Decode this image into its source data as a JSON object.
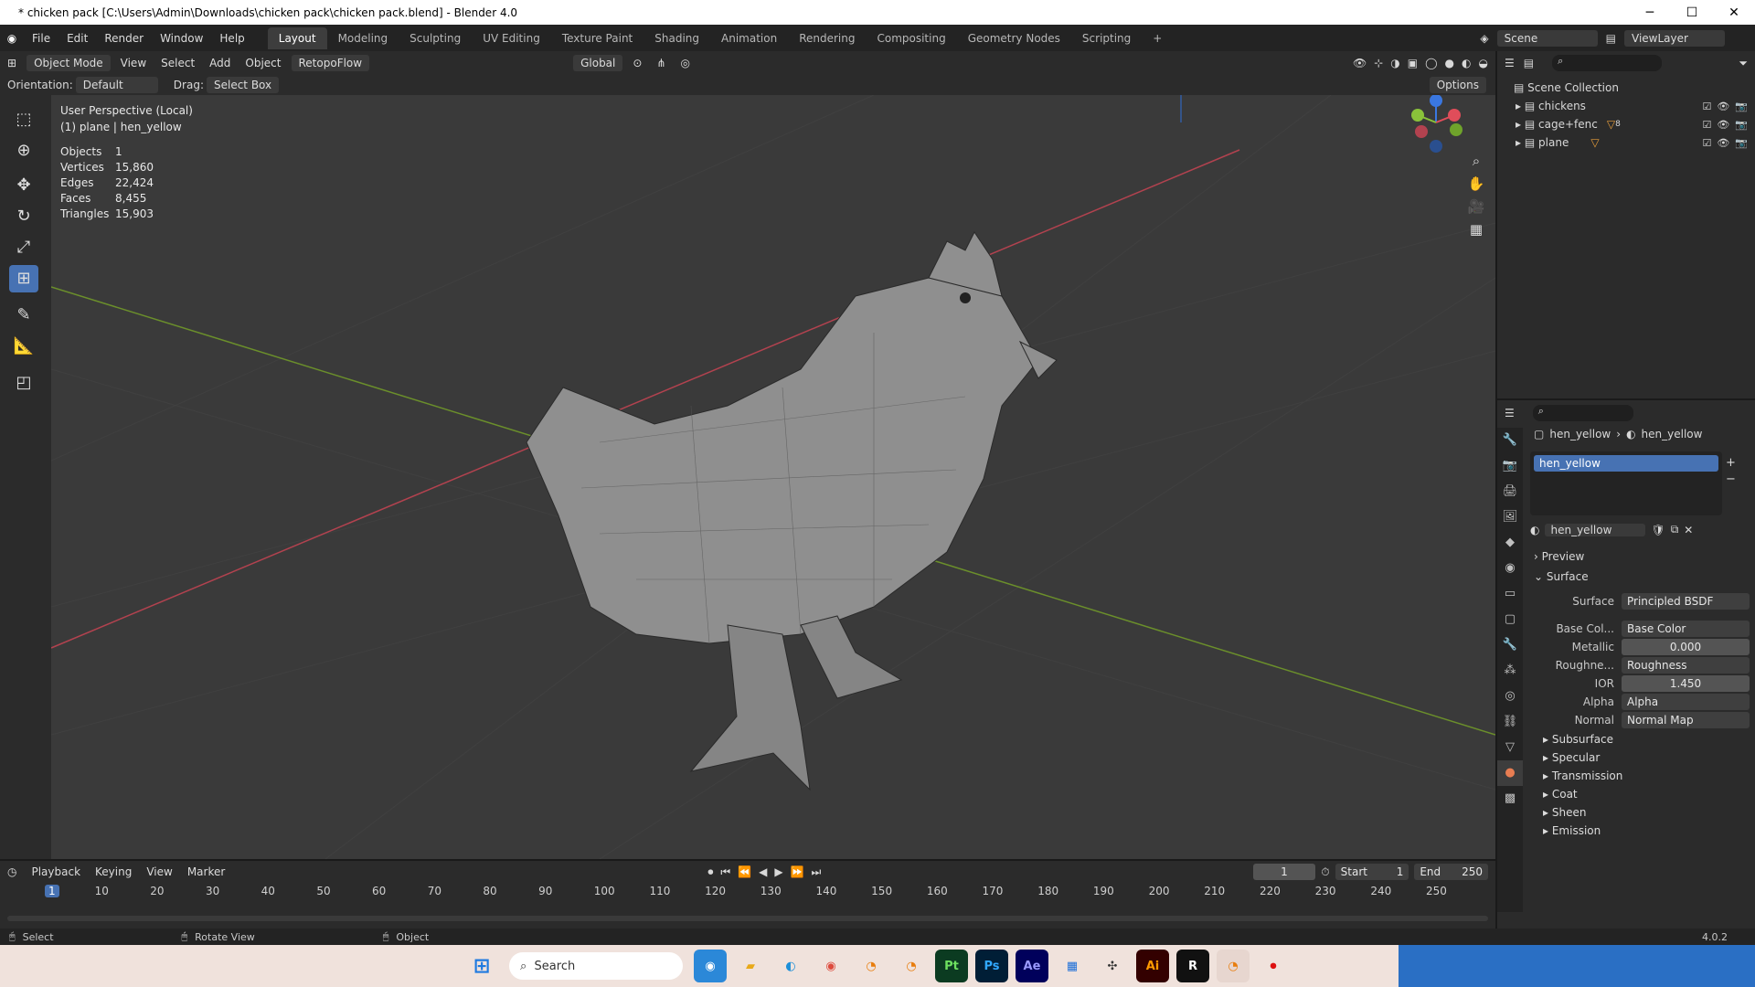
{
  "window": {
    "title": "* chicken pack [C:\\Users\\Admin\\Downloads\\chicken pack\\chicken pack.blend] - Blender 4.0",
    "minimize": "─",
    "maximize": "☐",
    "close": "✕"
  },
  "menu": [
    "File",
    "Edit",
    "Render",
    "Window",
    "Help"
  ],
  "workspaces": [
    "Layout",
    "Modeling",
    "Sculpting",
    "UV Editing",
    "Texture Paint",
    "Shading",
    "Animation",
    "Rendering",
    "Compositing",
    "Geometry Nodes",
    "Scripting",
    "+"
  ],
  "scene": "Scene",
  "view_layer": "ViewLayer",
  "header": {
    "mode": "Object Mode",
    "view": "View",
    "select": "Select",
    "add": "Add",
    "object": "Object",
    "addon": "RetopoFlow",
    "transform": "Global",
    "options": "Options"
  },
  "toolsettings": {
    "orientation_label": "Orientation:",
    "orientation": "Default",
    "drag_label": "Drag:",
    "drag": "Select Box"
  },
  "viewport": {
    "perspective": "User Perspective (Local)",
    "active": "(1) plane | hen_yellow",
    "stats": [
      {
        "label": "Objects",
        "value": "1"
      },
      {
        "label": "Vertices",
        "value": "15,860"
      },
      {
        "label": "Edges",
        "value": "22,424"
      },
      {
        "label": "Faces",
        "value": "8,455"
      },
      {
        "label": "Triangles",
        "value": "15,903"
      }
    ]
  },
  "outliner": {
    "root": "Scene Collection",
    "items": [
      {
        "name": "chickens"
      },
      {
        "name": "cage+fenc",
        "badge": "8"
      },
      {
        "name": "plane"
      }
    ]
  },
  "properties": {
    "breadcrumb_object": "hen_yellow",
    "breadcrumb_material": "hen_yellow",
    "slot": "hen_yellow",
    "material": "hen_yellow",
    "preview": "Preview",
    "surface_panel": "Surface",
    "rows": [
      {
        "label": "Surface",
        "value": "Principled BSDF"
      },
      {
        "label": "Base Col...",
        "value": "Base Color"
      },
      {
        "label": "Metallic",
        "value": "0.000"
      },
      {
        "label": "Roughne...",
        "value": "Roughness"
      },
      {
        "label": "IOR",
        "value": "1.450"
      },
      {
        "label": "Alpha",
        "value": "Alpha"
      },
      {
        "label": "Normal",
        "value": "Normal Map"
      }
    ],
    "subpanels": [
      "Subsurface",
      "Specular",
      "Transmission",
      "Coat",
      "Sheen",
      "Emission"
    ]
  },
  "timeline": {
    "playback": "Playback",
    "keying": "Keying",
    "view": "View",
    "marker": "Marker",
    "current_frame": "1",
    "start_label": "Start",
    "start": "1",
    "end_label": "End",
    "end": "250",
    "ticks": [
      "1",
      "10",
      "20",
      "30",
      "40",
      "50",
      "60",
      "70",
      "80",
      "90",
      "100",
      "110",
      "120",
      "130",
      "140",
      "150",
      "160",
      "170",
      "180",
      "190",
      "200",
      "210",
      "220",
      "230",
      "240",
      "250"
    ]
  },
  "status": {
    "left": "Select",
    "middle": "Rotate View",
    "right": "Object",
    "version": "4.0.2"
  },
  "taskbar": {
    "search": "Search"
  }
}
